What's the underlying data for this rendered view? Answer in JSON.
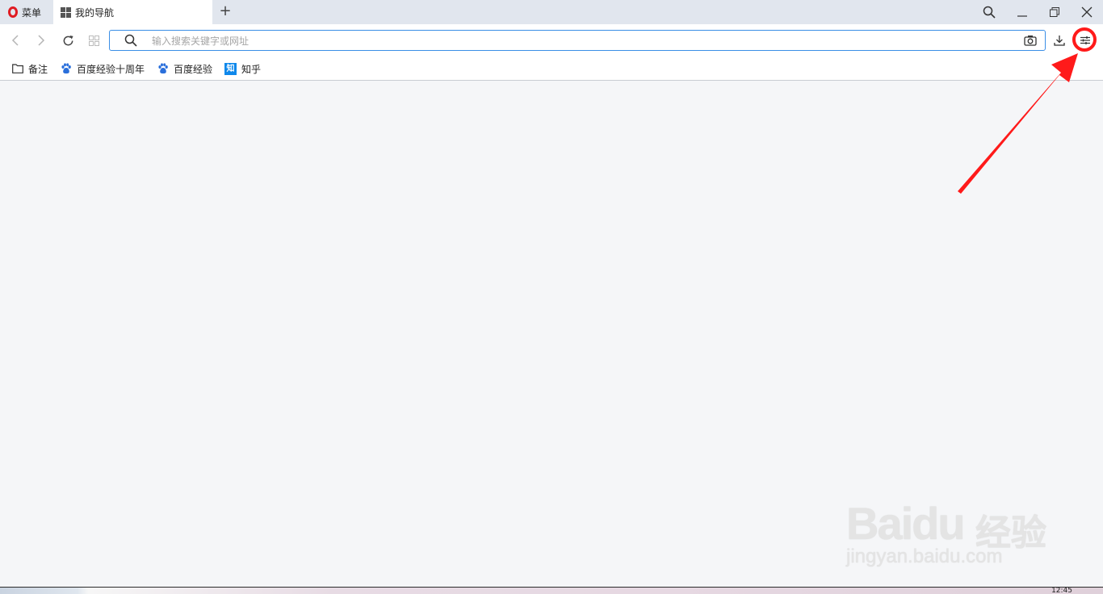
{
  "tabstrip": {
    "menu_label": "菜单",
    "tab_title": "我的导航",
    "new_tab_label": "+"
  },
  "toolbar": {
    "address_placeholder": "输入搜索关键字或网址",
    "address_value": ""
  },
  "bookmarks": [
    {
      "label": "备注",
      "icon": "folder-icon"
    },
    {
      "label": "百度经验十周年",
      "icon": "baidu-paw-icon"
    },
    {
      "label": "百度经验",
      "icon": "baidu-paw-icon"
    },
    {
      "label": "知乎",
      "icon": "zhihu-icon",
      "icon_text": "知"
    }
  ],
  "watermark": {
    "logo": "Baidu",
    "logo_cn": "经验",
    "url": "jingyan.baidu.com"
  },
  "taskbar": {
    "clock": "12:45"
  },
  "colors": {
    "opera_red": "#e01b22",
    "accent_blue": "#3a8ee6",
    "annotation_red": "#ff1a1a",
    "baidu_blue": "#2a6fdb",
    "zhihu_blue": "#0f88eb"
  }
}
